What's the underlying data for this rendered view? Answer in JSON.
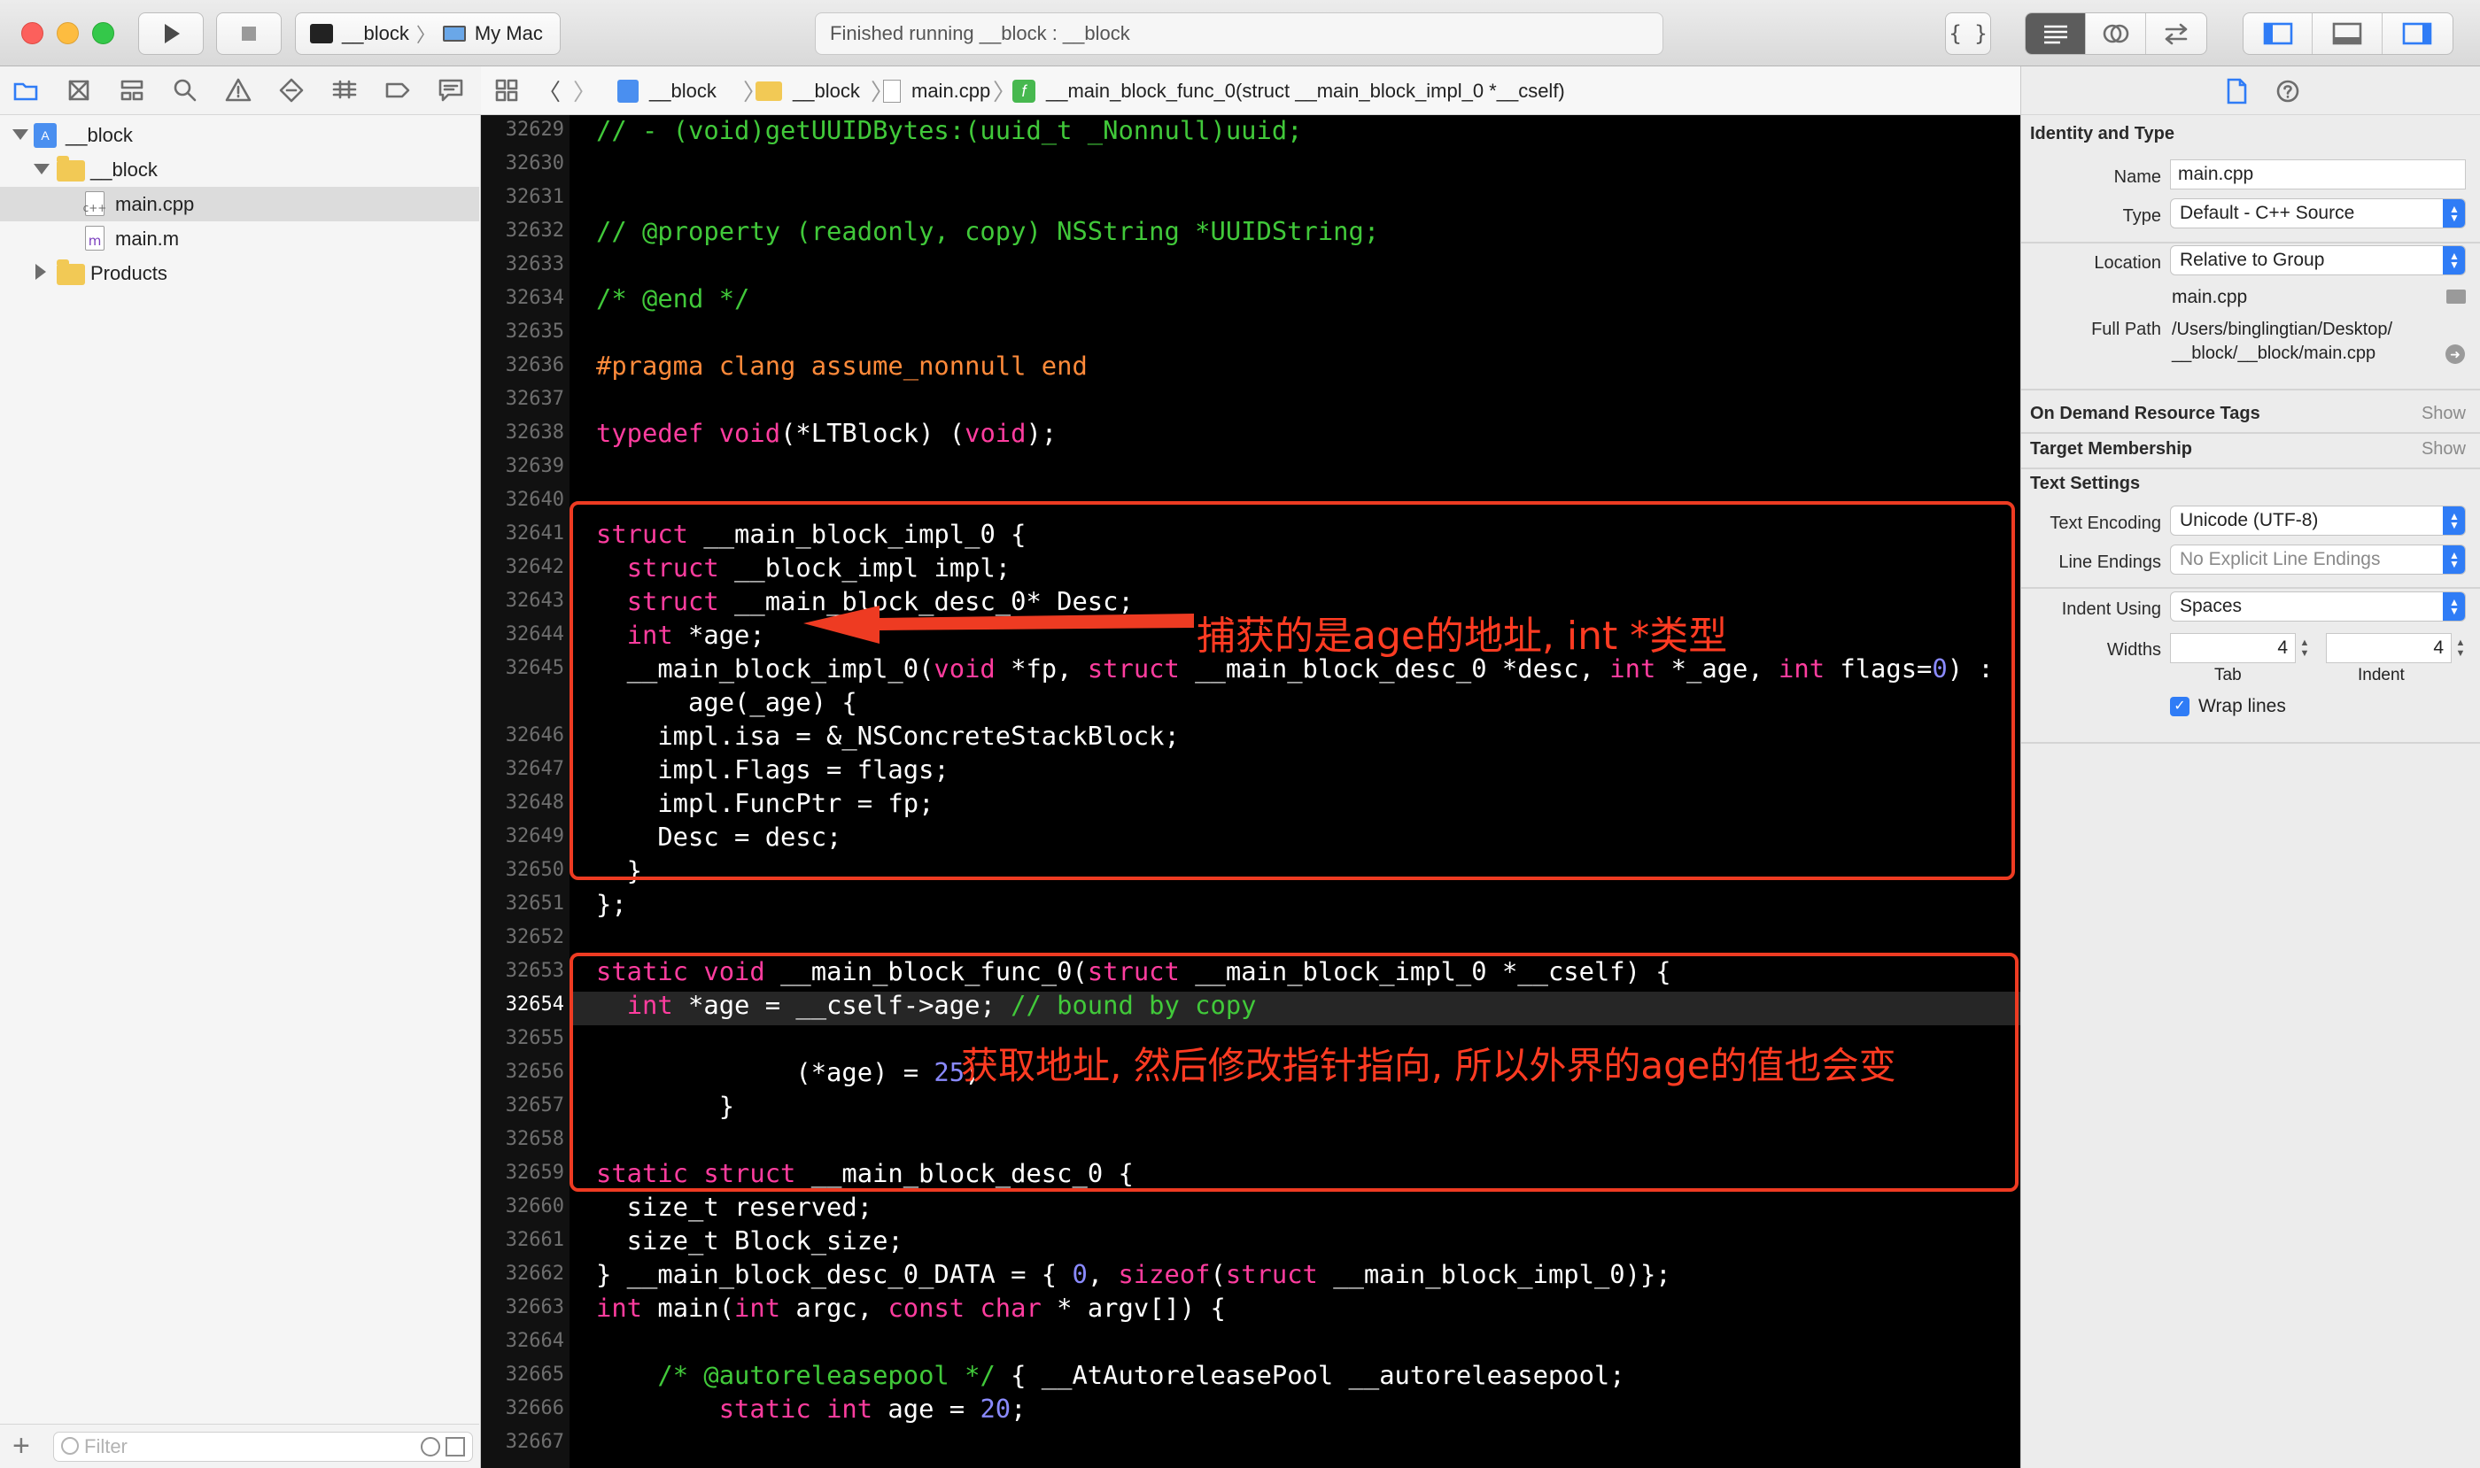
{
  "toolbar": {
    "scheme_target": "__block",
    "destination": "My Mac",
    "activity_status": "Finished running __block : __block"
  },
  "navigator": {
    "tree": [
      {
        "label": "__block",
        "kind": "project",
        "level": 0,
        "expanded": true
      },
      {
        "label": "__block",
        "kind": "folder",
        "level": 1,
        "expanded": true
      },
      {
        "label": "main.cpp",
        "kind": "file",
        "badge": "c++",
        "level": 2,
        "selected": true
      },
      {
        "label": "main.m",
        "kind": "file",
        "badge": "m",
        "level": 2
      },
      {
        "label": "Products",
        "kind": "folder",
        "level": 1,
        "expanded": false
      }
    ],
    "filter_placeholder": "Filter"
  },
  "jumpbar": {
    "crumbs": [
      "__block",
      "__block",
      "main.cpp",
      "__main_block_func_0(struct __main_block_impl_0 *__cself)"
    ]
  },
  "editor": {
    "current_line": "32654",
    "lines": [
      {
        "n": "32629",
        "html": "<span class='cm'>// - (void)getUUIDBytes:(uuid_t _Nonnull)uuid;</span>"
      },
      {
        "n": "32630",
        "html": ""
      },
      {
        "n": "32631",
        "html": ""
      },
      {
        "n": "32632",
        "html": "<span class='cm'>// @property (readonly, copy) NSString *UUIDString;</span>"
      },
      {
        "n": "32633",
        "html": ""
      },
      {
        "n": "32634",
        "html": "<span class='cm'>/* @end */</span>"
      },
      {
        "n": "32635",
        "html": ""
      },
      {
        "n": "32636",
        "html": "<span class='pp'>#pragma clang assume_nonnull end</span>"
      },
      {
        "n": "32637",
        "html": ""
      },
      {
        "n": "32638",
        "html": "<span class='kw'>typedef</span> <span class='kw'>void</span>(*LTBlock) (<span class='kw'>void</span>);"
      },
      {
        "n": "32639",
        "html": ""
      },
      {
        "n": "32640",
        "html": ""
      },
      {
        "n": "32641",
        "html": "<span class='kw'>struct</span> __main_block_impl_0 {"
      },
      {
        "n": "32642",
        "html": "  <span class='kw'>struct</span> __block_impl impl;"
      },
      {
        "n": "32643",
        "html": "  <span class='kw'>struct</span> __main_block_desc_0* Desc;"
      },
      {
        "n": "32644",
        "html": "  <span class='kw'>int</span> *age;"
      },
      {
        "n": "32645",
        "html": "  __main_block_impl_0(<span class='kw'>void</span> *fp, <span class='kw'>struct</span> __main_block_desc_0 *desc, <span class='kw'>int</span> *_age, <span class='kw'>int</span> flags=<span class='num'>0</span>) :"
      },
      {
        "n": "",
        "html": "      age(_age) {"
      },
      {
        "n": "32646",
        "html": "    impl.isa = &amp;_NSConcreteStackBlock;"
      },
      {
        "n": "32647",
        "html": "    impl.Flags = flags;"
      },
      {
        "n": "32648",
        "html": "    impl.FuncPtr = fp;"
      },
      {
        "n": "32649",
        "html": "    Desc = desc;"
      },
      {
        "n": "32650",
        "html": "  }"
      },
      {
        "n": "32651",
        "html": "};"
      },
      {
        "n": "32652",
        "html": ""
      },
      {
        "n": "32653",
        "html": "<span class='kw'>static</span> <span class='kw'>void</span> __main_block_func_0(<span class='kw'>struct</span> __main_block_impl_0 *__cself) {"
      },
      {
        "n": "32654",
        "html": "  <span class='kw'>int</span> *age = __cself-&gt;age; <span class='cm'>// bound by copy</span>"
      },
      {
        "n": "32655",
        "html": ""
      },
      {
        "n": "32656",
        "html": "             (*age) = <span class='num'>25</span>;"
      },
      {
        "n": "32657",
        "html": "        }"
      },
      {
        "n": "32658",
        "html": ""
      },
      {
        "n": "32659",
        "html": "<span class='kw'>static</span> <span class='kw'>struct</span> __main_block_desc_0 {"
      },
      {
        "n": "32660",
        "html": "  size_t reserved;"
      },
      {
        "n": "32661",
        "html": "  size_t Block_size;"
      },
      {
        "n": "32662",
        "html": "} __main_block_desc_0_DATA = { <span class='num'>0</span>, <span class='kw'>sizeof</span>(<span class='kw'>struct</span> __main_block_impl_0)};"
      },
      {
        "n": "32663",
        "html": "<span class='kw'>int</span> main(<span class='kw'>int</span> argc, <span class='kw'>const</span> <span class='kw'>char</span> * argv[]) {"
      },
      {
        "n": "32664",
        "html": ""
      },
      {
        "n": "32665",
        "html": "    <span class='cm'>/* @autoreleasepool */</span> { __AtAutoreleasePool __autoreleasepool;"
      },
      {
        "n": "32666",
        "html": "        <span class='kw'>static</span> <span class='kw'>int</span> age = <span class='num'>20</span>;"
      },
      {
        "n": "32667",
        "html": ""
      }
    ],
    "annotation_1": "捕获的是age的地址, int *类型",
    "annotation_2": "获取地址, 然后修改指针指向, 所以外界的age的值也会变",
    "annotation_color": "#ee3b22"
  },
  "inspector": {
    "identity_title": "Identity and Type",
    "name_label": "Name",
    "name_value": "main.cpp",
    "type_label": "Type",
    "type_value": "Default - C++ Source",
    "location_label": "Location",
    "location_value": "Relative to Group",
    "location_file": "main.cpp",
    "fullpath_label": "Full Path",
    "fullpath_line1": "/Users/binglingtian/Desktop/",
    "fullpath_line2": "__block/__block/main.cpp",
    "odr_title": "On Demand Resource Tags",
    "odr_show": "Show",
    "target_title": "Target Membership",
    "target_show": "Show",
    "text_title": "Text Settings",
    "encoding_label": "Text Encoding",
    "encoding_value": "Unicode (UTF-8)",
    "lineend_label": "Line Endings",
    "lineend_value": "No Explicit Line Endings",
    "indentusing_label": "Indent Using",
    "indentusing_value": "Spaces",
    "widths_label": "Widths",
    "tab_value": "4",
    "indent_value": "4",
    "tab_caption": "Tab",
    "indent_caption": "Indent",
    "wrap_label": "Wrap lines",
    "wrap_checked": true
  },
  "colors": {
    "accent": "#2f7cf6",
    "annotation": "#ee3b22"
  }
}
